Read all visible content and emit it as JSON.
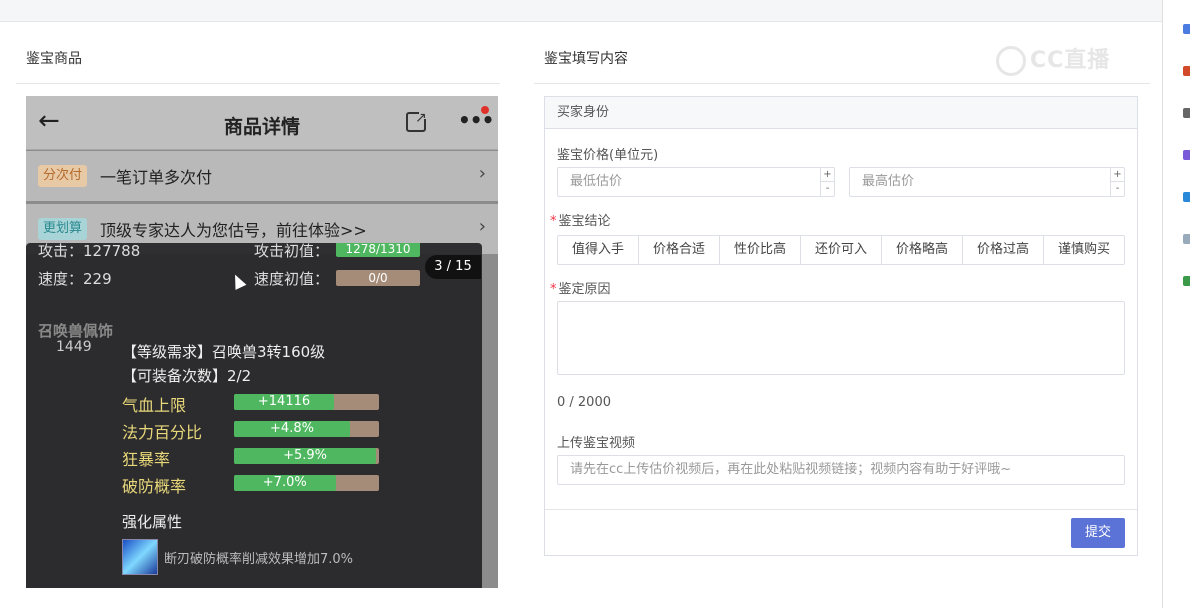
{
  "left_panel": {
    "title": "鉴宝商品"
  },
  "right_panel": {
    "title": "鉴宝填写内容"
  },
  "watermark": "CC直播",
  "phone": {
    "header_title": "商品详情",
    "rows": [
      {
        "badge": "分次付",
        "badge_color": "#e8c9a6",
        "badge_text_color": "#b36a2a",
        "text": "一笔订单多次付"
      },
      {
        "badge": "更划算",
        "badge_color": "#a8d4d8",
        "badge_text_color": "#2a8a8f",
        "text": "顶级专家达人为您估号，前往体验>>"
      }
    ]
  },
  "overlay": {
    "pager": "3 / 15",
    "attack_label": "攻击：127788",
    "attack_init_label": "攻击初值：",
    "attack_init_value": "1278/1310",
    "speed_label": "速度：229",
    "speed_init_label": "速度初值：",
    "speed_init_value": "0/0",
    "section_title": "召唤兽佩饰",
    "item_id": "1449",
    "requirement": "【等级需求】召唤兽3转160级",
    "equip_times": "【可装备次数】2/2",
    "attributes": [
      {
        "label": "气血上限",
        "value": "+14116",
        "fill": 0.69
      },
      {
        "label": "法力百分比",
        "value": "+4.8%",
        "fill": 0.8
      },
      {
        "label": "狂暴率",
        "value": "+5.9%",
        "fill": 0.98
      },
      {
        "label": "破防概率",
        "value": "+7.0%",
        "fill": 0.7
      }
    ],
    "enhance_title": "强化属性",
    "enhance_text": "断刃破防概率削减效果增加7.0%"
  },
  "form": {
    "section_title": "买家身份",
    "price_label": "鉴宝价格(单位元)",
    "min_placeholder": "最低估价",
    "max_placeholder": "最高估价",
    "conclusion_label": "鉴宝结论",
    "conclusions": [
      "值得入手",
      "价格合适",
      "性价比高",
      "还价可入",
      "价格略高",
      "价格过高",
      "谨慎购买"
    ],
    "reason_label": "鉴定原因",
    "counter": "0 / 2000",
    "video_label": "上传鉴宝视频",
    "video_placeholder": "请先在cc上传估价视频后，再在此处粘贴视频链接；视频内容有助于好评哦~",
    "submit": "提交"
  }
}
